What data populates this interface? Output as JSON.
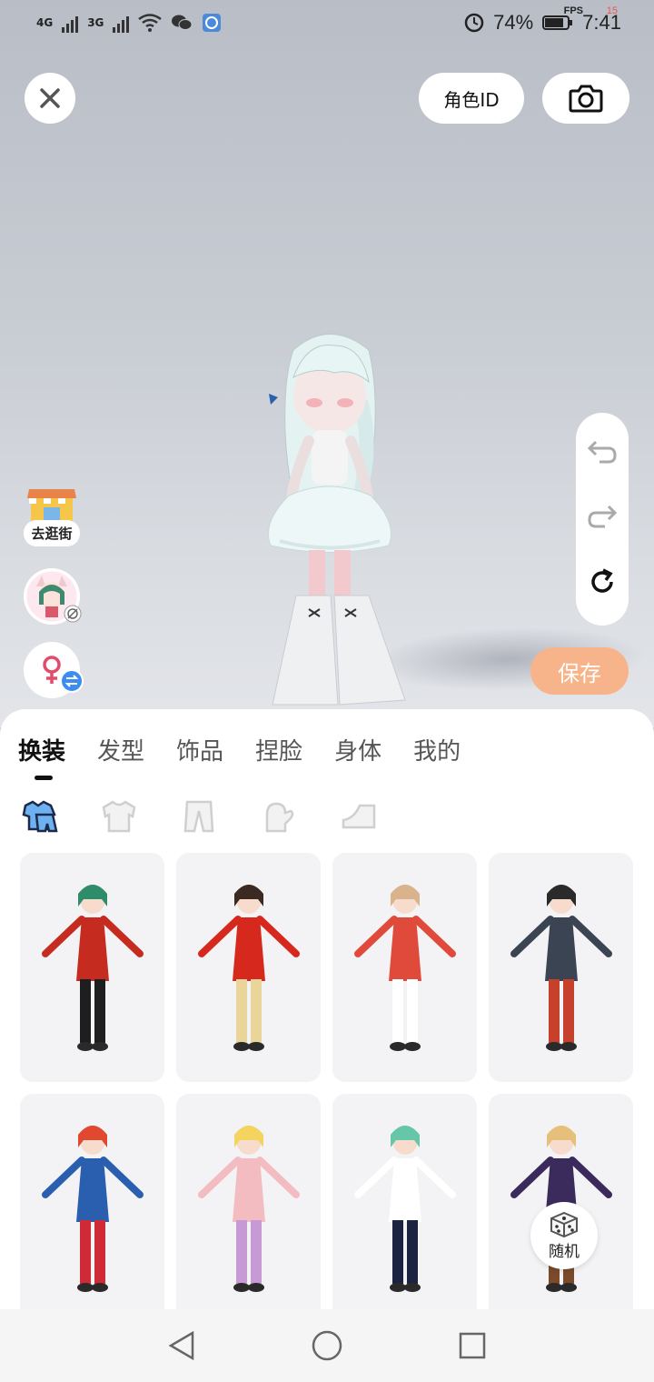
{
  "status_bar": {
    "network1": "4G",
    "network2": "3G",
    "battery": "74%",
    "time": "7:41",
    "fps_label": "FPS",
    "fps_value": "15"
  },
  "top": {
    "role_id_label": "角色ID",
    "close_icon": "close-icon",
    "camera_icon": "camera-icon"
  },
  "side": {
    "shop_label": "去逛街"
  },
  "history": {
    "undo_icon": "undo-icon",
    "redo_icon": "redo-icon",
    "reset_icon": "reset-icon"
  },
  "save_label": "保存",
  "tabs": [
    {
      "label": "换装",
      "active": true
    },
    {
      "label": "发型"
    },
    {
      "label": "饰品"
    },
    {
      "label": "捏脸"
    },
    {
      "label": "身体"
    },
    {
      "label": "我的"
    }
  ],
  "subcategories": [
    "outfit-icon",
    "top-icon",
    "pants-icon",
    "gloves-icon",
    "shoes-icon"
  ],
  "outfits": [
    {
      "name": "outfit-card-1",
      "colors": [
        "#c62b1f",
        "#1e1e1e",
        "#2f8c6b"
      ]
    },
    {
      "name": "outfit-card-2",
      "colors": [
        "#d7281e",
        "#e9d59a",
        "#3a2a22"
      ]
    },
    {
      "name": "outfit-card-3",
      "colors": [
        "#e04a3a",
        "#ffffff",
        "#d9b38c"
      ]
    },
    {
      "name": "outfit-card-4",
      "colors": [
        "#3b4452",
        "#c7402c",
        "#2a2a2a"
      ]
    },
    {
      "name": "outfit-card-5",
      "colors": [
        "#2a5fb0",
        "#cf2a36",
        "#e0482f"
      ]
    },
    {
      "name": "outfit-card-6",
      "colors": [
        "#f2bcc0",
        "#c79ad6",
        "#f4d35e"
      ]
    },
    {
      "name": "outfit-card-7",
      "colors": [
        "#ffffff",
        "#1c2340",
        "#66c7a8"
      ]
    },
    {
      "name": "outfit-card-8",
      "colors": [
        "#3b2a5c",
        "#7a4a2a",
        "#e6c07a"
      ]
    }
  ],
  "random_label": "随机",
  "colors": {
    "accent_save": "#f7b48a",
    "sheet_bg": "#ffffff",
    "card_bg": "#f3f3f5"
  }
}
